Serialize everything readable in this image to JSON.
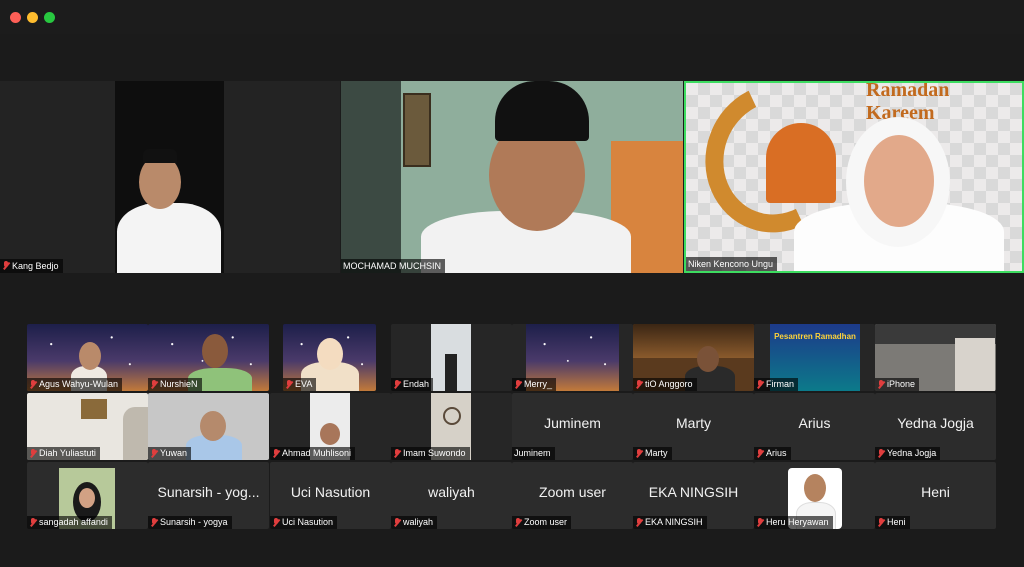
{
  "window": {
    "controls": [
      "close",
      "minimize",
      "maximize"
    ]
  },
  "speakers": [
    {
      "id": "kang-bedjo",
      "name": "Kang Bedjo",
      "muted": true
    },
    {
      "id": "mochamad-muchsin",
      "name": "MOCHAMAD MUCHSIN",
      "muted": false
    },
    {
      "id": "niken",
      "name": "Niken Kencono Ungu",
      "muted": false,
      "active": true,
      "background_text": "Ramadan Kareem"
    }
  ],
  "gallery": {
    "row1": [
      {
        "name": "Agus Wahyu-Wulan",
        "muted": true,
        "video": true
      },
      {
        "name": "NurshieN",
        "muted": true,
        "video": true
      },
      {
        "name": "EVA",
        "muted": true,
        "video": true
      },
      {
        "name": "Endah",
        "muted": true,
        "video": true
      },
      {
        "name": "Merry_",
        "muted": true,
        "video": true
      },
      {
        "name": "tiO Anggoro",
        "muted": true,
        "video": true
      },
      {
        "name": "Firman",
        "muted": true,
        "video": true,
        "background_text": "Pesantren Ramadhan"
      },
      {
        "name": "iPhone",
        "muted": true,
        "video": true
      }
    ],
    "row2": [
      {
        "name": "Diah Yuliastuti",
        "muted": true,
        "video": true
      },
      {
        "name": "Yuwan",
        "muted": true,
        "video": true
      },
      {
        "name": "Ahmad Muhlisoni",
        "muted": true,
        "video": true
      },
      {
        "name": "Imam Suwondo",
        "muted": true,
        "video": true
      },
      {
        "name": "Juminem",
        "display": "Juminem",
        "muted": false,
        "video": false
      },
      {
        "name": "Marty",
        "display": "Marty",
        "muted": true,
        "video": false
      },
      {
        "name": "Arius",
        "display": "Arius",
        "muted": true,
        "video": false
      },
      {
        "name": "Yedna Jogja",
        "display": "Yedna Jogja",
        "muted": true,
        "video": false
      }
    ],
    "row3": [
      {
        "name": "sangadah affandi",
        "muted": true,
        "video": true
      },
      {
        "name": "Sunarsih - yogya",
        "display": "Sunarsih - yog...",
        "muted": true,
        "video": false
      },
      {
        "name": "Uci Nasution",
        "display": "Uci Nasution",
        "muted": true,
        "video": false
      },
      {
        "name": "waliyah",
        "display": "waliyah",
        "muted": true,
        "video": false
      },
      {
        "name": "Zoom user",
        "display": "Zoom user",
        "muted": true,
        "video": false
      },
      {
        "name": "EKA NINGSIH",
        "display": "EKA NINGSIH",
        "muted": true,
        "video": false
      },
      {
        "name": "Heru Heryawan",
        "muted": true,
        "video": true
      },
      {
        "name": "Heni",
        "display": "Heni",
        "muted": true,
        "video": false
      }
    ]
  },
  "colors": {
    "active_speaker_border": "#3ddc60",
    "muted_mic": "#e03e3e",
    "tile_bg": "#2c2c2c"
  }
}
